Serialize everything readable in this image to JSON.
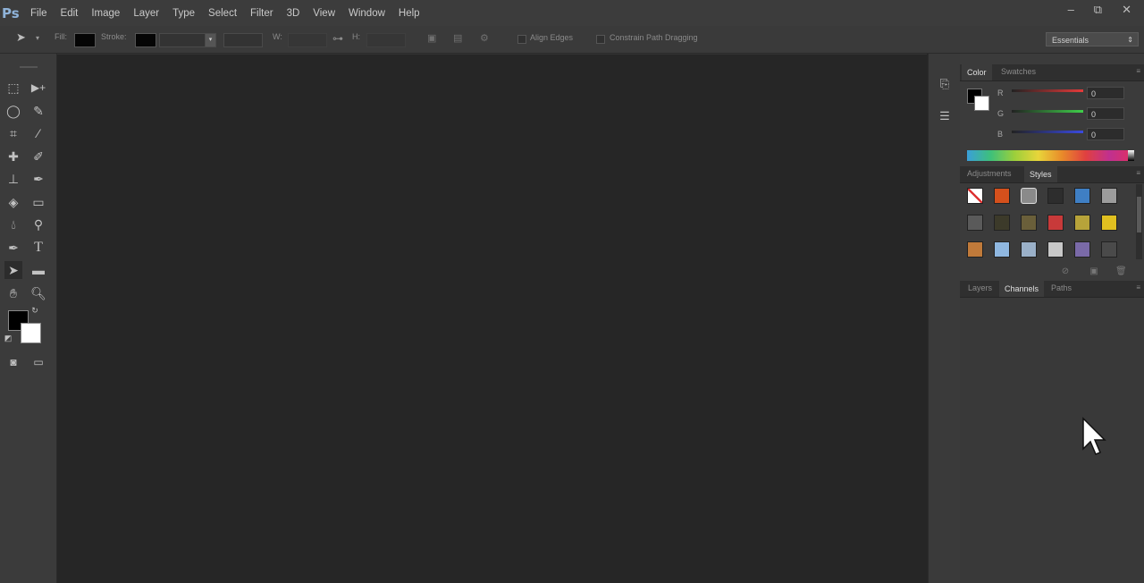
{
  "app": {
    "logo": "Ps"
  },
  "menu": [
    "File",
    "Edit",
    "Image",
    "Layer",
    "Type",
    "Select",
    "Filter",
    "3D",
    "View",
    "Window",
    "Help"
  ],
  "window_controls": {
    "minimize": "–",
    "restore": "⧉",
    "close": "✕"
  },
  "options_bar": {
    "fill_label": "Fill:",
    "stroke_label": "Stroke:",
    "w_label": "W:",
    "h_label": "H:",
    "align_edges_label": "Align Edges",
    "constrain_label": "Constrain Path Dragging",
    "workspace": "Essentials"
  },
  "color_panel": {
    "tabs": [
      "Color",
      "Swatches"
    ],
    "channels": [
      {
        "label": "R",
        "value": "0"
      },
      {
        "label": "G",
        "value": "0"
      },
      {
        "label": "B",
        "value": "0"
      }
    ],
    "foreground": "#000000",
    "background": "#ffffff"
  },
  "styles_panel": {
    "tabs": [
      "Adjustments",
      "Styles"
    ],
    "swatches": [
      "#ffffff",
      "#d4501c",
      "#8a8a8a",
      "#2d2d2d",
      "#3f7fc4",
      "#9c9c9c",
      "#5a5a5a",
      "#3c3a2a",
      "#6a5f3a",
      "#c83a3a",
      "#b7a33a",
      "#e0c020",
      "#c07a3a",
      "#8fb7e0",
      "#9ab0c8",
      "#c8c8c8",
      "#7a6aa8",
      "#4a4a4a"
    ]
  },
  "layers_panel": {
    "tabs": [
      "Layers",
      "Channels",
      "Paths"
    ]
  },
  "colors": {
    "menubar": "#3c3c3c",
    "panel": "#3b3b3b",
    "canvas": "#262626"
  }
}
